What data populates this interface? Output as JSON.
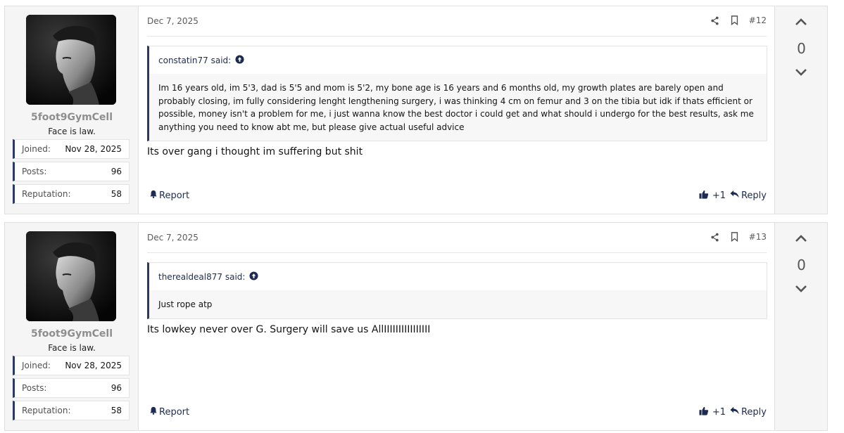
{
  "posts": [
    {
      "author": {
        "username": "5foot9GymCell",
        "title": "Face is law.",
        "stats": [
          {
            "label": "Joined:",
            "value": "Nov 28, 2025"
          },
          {
            "label": "Posts:",
            "value": "96"
          },
          {
            "label": "Reputation:",
            "value": "58"
          }
        ]
      },
      "date": "Dec 7, 2025",
      "number": "#12",
      "quote": {
        "author": "constatin77 said:",
        "text": "Im 16 years old, im 5'3, dad is 5'5 and mom is 5'2, my bone age is 16 years and 6 months old, my growth plates are barely open and probably closing, im fully considering lenght lengthening surgery, i was thinking 4 cm on femur and 3 on the tibia but idk if thats efficient or possible, money isn't a problem for me, i just wanna know the best doctor i could get and what should i undergo for the best results, ask me anything you need to know abt me, but please give actual useful advice"
      },
      "message": "Its over gang i thought im suffering but shit",
      "report_label": "Report",
      "reaction_label": "+1",
      "reply_label": "Reply",
      "votes": "0"
    },
    {
      "author": {
        "username": "5foot9GymCell",
        "title": "Face is law.",
        "stats": [
          {
            "label": "Joined:",
            "value": "Nov 28, 2025"
          },
          {
            "label": "Posts:",
            "value": "96"
          },
          {
            "label": "Reputation:",
            "value": "58"
          }
        ]
      },
      "date": "Dec 7, 2025",
      "number": "#13",
      "quote": {
        "author": "therealdeal877 said:",
        "text": "Just rope atp"
      },
      "message": "Its lowkey never over G. Surgery will save us AllIIIIIIIIIIIIIIII",
      "report_label": "Report",
      "reaction_label": "+1",
      "reply_label": "Reply",
      "votes": "0"
    }
  ],
  "icons": {
    "share": "share-icon",
    "bookmark": "bookmark-icon",
    "quote_jump": "arrow-circle-up-icon",
    "report": "bell-icon",
    "like": "thumbs-up-icon",
    "reply": "reply-icon",
    "vote_up": "chevron-up-icon",
    "vote_down": "chevron-down-icon"
  },
  "colors": {
    "accent": "#2b3a63",
    "link": "#1d2b50",
    "username": "#8e8e8e"
  }
}
